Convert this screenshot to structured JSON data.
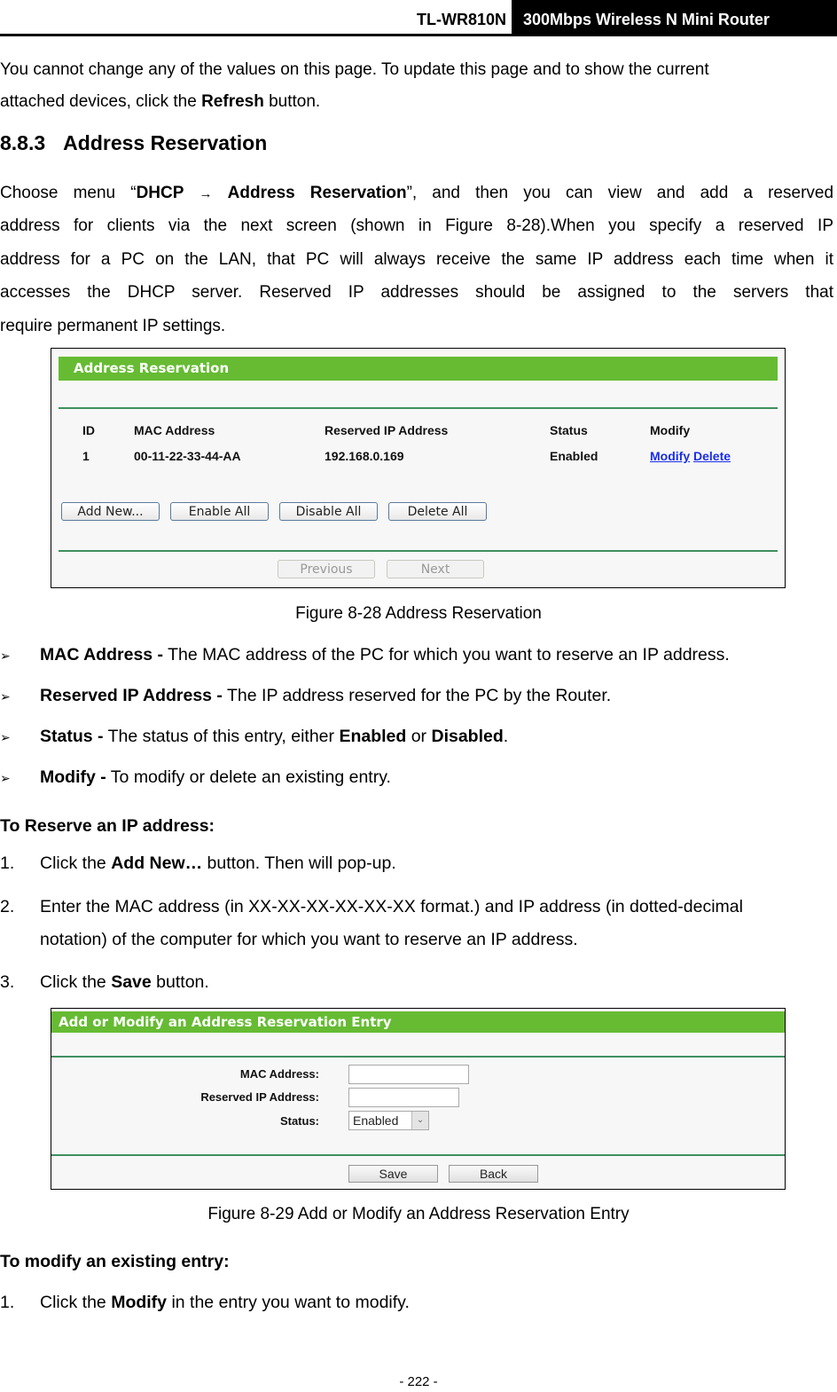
{
  "header": {
    "model": "TL-WR810N",
    "product": "300Mbps Wireless N Mini Router"
  },
  "intro": {
    "line1": "You cannot change any of the values on this page. To update this page and to show the current",
    "line2_pre": "attached devices, click the ",
    "line2_bold": "Refresh",
    "line2_post": " button."
  },
  "section": {
    "number": "8.8.3",
    "title": "Address Reservation"
  },
  "para": {
    "l1_pre": "Choose menu “",
    "l1_b1": "DHCP",
    "l1_arrow": "→",
    "l1_b2": "Address Reservation",
    "l1_post": "”, and then you can view and add a reserved",
    "l2": "address for clients via the next screen (shown in Figure 8-28).When you specify a reserved IP",
    "l3": "address for a PC on the LAN, that PC will always receive the same IP address each time when it",
    "l4": "accesses the DHCP server. Reserved IP addresses should be assigned to the servers that",
    "l5": "require permanent IP settings."
  },
  "figure1": {
    "title": "Address Reservation",
    "columns": [
      "ID",
      "MAC Address",
      "Reserved IP Address",
      "Status",
      "Modify"
    ],
    "rows": [
      {
        "id": "1",
        "mac": "00-11-22-33-44-AA",
        "ip": "192.168.0.169",
        "status": "Enabled",
        "modify": "Modify",
        "delete": "Delete"
      }
    ],
    "buttons": {
      "add_new": "Add New...",
      "enable_all": "Enable All",
      "disable_all": "Disable All",
      "delete_all": "Delete All",
      "previous": "Previous",
      "next": "Next"
    },
    "caption": "Figure 8-28 Address Reservation"
  },
  "bullets": [
    {
      "bold": "MAC Address -",
      "text": " The MAC address of the PC for which you want to reserve an IP address."
    },
    {
      "bold": "Reserved IP Address -",
      "text": " The IP address reserved for the PC by the Router."
    },
    {
      "bold": "Status -",
      "text": " The status of this entry, either ",
      "bold2": "Enabled",
      "text2": " or ",
      "bold3": "Disabled",
      "text3": "."
    },
    {
      "bold": "Modify -",
      "text": " To modify or delete an existing entry."
    }
  ],
  "bullet_icon": "➢",
  "reserve": {
    "heading": "To Reserve an IP address:",
    "steps": [
      {
        "n": "1.",
        "pre": "Click the ",
        "bold": "Add New…",
        "post": " button. Then will pop-up."
      },
      {
        "n": "2.",
        "line1": "Enter the MAC address (in XX-XX-XX-XX-XX-XX format.) and IP address (in dotted-decimal",
        "line2": "notation) of the computer for which you want to reserve an IP address."
      },
      {
        "n": "3.",
        "pre": "Click the ",
        "bold": "Save",
        "post": " button."
      }
    ]
  },
  "figure2": {
    "title": "Add or Modify an Address Reservation Entry",
    "mac_label": "MAC Address:",
    "mac_value": "",
    "ip_label": "Reserved IP Address:",
    "ip_value": "",
    "status_label": "Status:",
    "status_value": "Enabled",
    "save": "Save",
    "back": "Back",
    "caption": "Figure 8-29 Add or Modify an Address Reservation Entry"
  },
  "modify": {
    "heading": "To modify an existing entry:",
    "steps": [
      {
        "n": "1.",
        "pre": "Click the ",
        "bold": "Modify",
        "post": " in the entry you want to modify."
      }
    ]
  },
  "footer": {
    "page": "- 222 -"
  }
}
